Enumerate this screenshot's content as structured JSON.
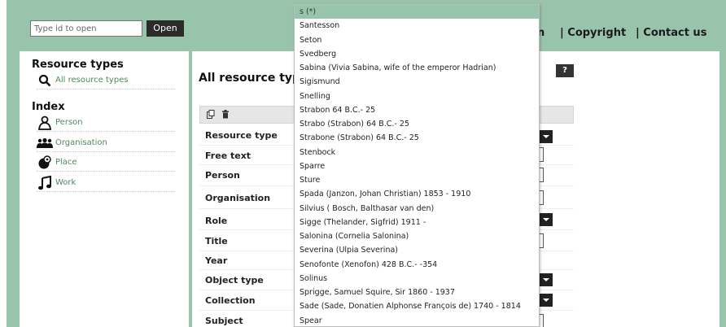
{
  "header": {
    "id_input_placeholder": "Type id to open",
    "open_button": "Open",
    "nav": [
      "n",
      "| Copyright",
      "| Contact us"
    ]
  },
  "sidebar": {
    "resource_types_heading": "Resource types",
    "resource_types_items": [
      {
        "label": "All resource types",
        "icon": "search-icon"
      }
    ],
    "index_heading": "Index",
    "index_items": [
      {
        "label": "Person",
        "icon": "person-icon"
      },
      {
        "label": "Organisation",
        "icon": "group-icon"
      },
      {
        "label": "Place",
        "icon": "map-pin-icon"
      },
      {
        "label": "Work",
        "icon": "music-note-icon"
      }
    ]
  },
  "main": {
    "title": "All resource typ",
    "help_button": "?",
    "toolbar_icons": [
      "copy-icon",
      "trash-icon"
    ],
    "fields": [
      "Resource type",
      "Free text",
      "Person",
      "Organisation",
      "Role",
      "Title",
      "Year",
      "Object type",
      "Collection",
      "Subject"
    ]
  },
  "autocomplete": {
    "items": [
      "s (*)",
      "Santesson",
      "Seton",
      "Svedberg",
      "Sabina (Vivia Sabina, wife of the emperor Hadrian)",
      "Sigismund",
      "Snelling",
      "Strabon 64 B.C.- 25",
      "Strabo (Strabon) 64 B.C.- 25",
      "Strabone (Strabon) 64 B.C.- 25",
      "Stenbock",
      "Sparre",
      "Sture",
      "Spada (Janzon, Johan Christian) 1853 - 1910",
      "Silvius ( Bosch, Balthasar van den)",
      "Sigge (Thelander, Sigfrid) 1911 -",
      "Salonina (Cornelia Salonina)",
      "Severina (Ulpia Severina)",
      "Senofonte (Xenofon) 428 B.C.- -354",
      "Solinus",
      "Sprigge, Samuel Squire, Sir 1860 - 1937",
      "Sade (Sade, Donatien Alphonse François de) 1740 - 1814",
      "Spear"
    ]
  },
  "colors": {
    "accent": "#98c4ac",
    "link": "#4d8a5f",
    "dark_button": "#2b2b2b"
  }
}
